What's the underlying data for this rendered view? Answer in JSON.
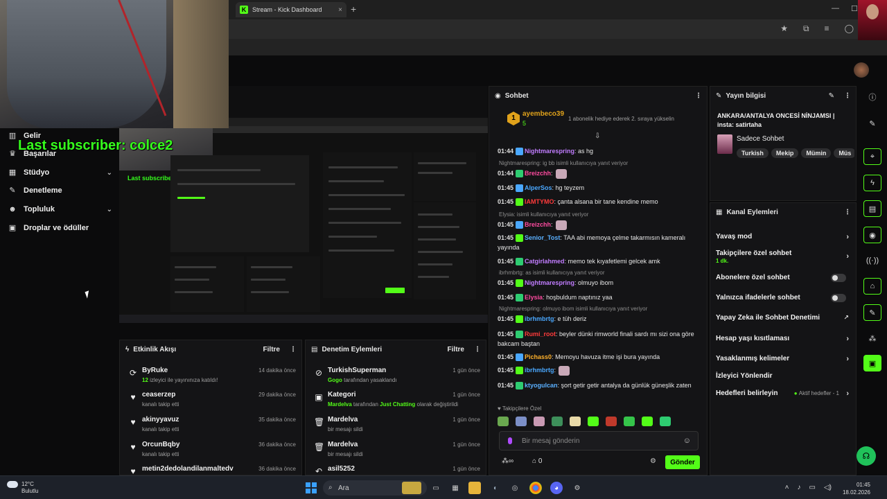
{
  "browser": {
    "tab_title": "Stream - Kick Dashboard",
    "tab_favicon": "K",
    "new_tab": "+",
    "close_tab": "×"
  },
  "overlay": {
    "last_subscriber": "Last subscriber: colce2",
    "preview_last_subscriber": "Last subscriber: colce2"
  },
  "nav": {
    "items": [
      {
        "label": "Gelir",
        "icon": "chart-icon"
      },
      {
        "label": "Başarılar",
        "icon": "trophy-icon"
      },
      {
        "label": "Stüdyo",
        "icon": "studio-icon",
        "expand": true
      },
      {
        "label": "Denetleme",
        "icon": "wrench-icon"
      },
      {
        "label": "Topluluk",
        "icon": "people-icon",
        "expand": true
      },
      {
        "label": "Droplar ve ödüller",
        "icon": "gift-icon"
      }
    ]
  },
  "activity": {
    "title": "Etkinlik Akışı",
    "filter": "Filtre",
    "rows": [
      {
        "title": "ByRuke",
        "sub_count": "12",
        "sub_text": " izleyici ile yayınınıza katıldı!",
        "time": "14 dakika önce",
        "icon": "raid-icon"
      },
      {
        "title": "ceaserzep",
        "sub_text": "kanalı takip etti",
        "time": "29 dakika önce",
        "icon": "heart-icon"
      },
      {
        "title": "akinyyavuz",
        "sub_text": "kanalı takip etti",
        "time": "35 dakika önce",
        "icon": "heart-icon"
      },
      {
        "title": "OrcunBqby",
        "sub_text": "kanalı takip etti",
        "time": "36 dakika önce",
        "icon": "heart-icon"
      },
      {
        "title": "metin2dedolandilanmaltedv",
        "sub_text": "",
        "time": "36 dakika önce",
        "icon": "heart-icon"
      }
    ]
  },
  "moderation": {
    "title": "Denetim Eylemleri",
    "filter": "Filtre",
    "rows": [
      {
        "title": "TurkishSuperman",
        "actor": "Gogo",
        "sub_text": " tarafından yasaklandı",
        "time": "1 gün önce",
        "icon": "ban-icon"
      },
      {
        "title": "Kategori",
        "actor": "Mardelva",
        "sub_text": " tarafından ",
        "target": "Just Chatting",
        "sub_text2": " olarak değiştirildi",
        "time": "1 gün önce",
        "icon": "category-icon"
      },
      {
        "title": "Mardelva",
        "sub_text": "bir mesajı sildi",
        "time": "1 gün önce",
        "icon": "trash-icon"
      },
      {
        "title": "Mardelva",
        "sub_text": "bir mesajı sildi",
        "time": "1 gün önce",
        "icon": "trash-icon"
      },
      {
        "title": "asil5252",
        "sub_text": "",
        "time": "1 gün önce",
        "icon": "undo-icon"
      }
    ]
  },
  "chat": {
    "title": "Sohbet",
    "pinned_user": "ayembeco39",
    "pinned_count": "5",
    "pinned_level": "1",
    "pinned_text": "1 abonelik hediye ederek 2. sıraya yükselin",
    "messages": [
      {
        "time": "01:44",
        "user": "Nightmarespring",
        "color": "#c17dff",
        "text": ": as hg"
      },
      {
        "reply": "Nightmarespring: ig bb isimli kullanıcıya yanıt veriyor"
      },
      {
        "time": "01:44",
        "user": "Breizchh",
        "color": "#ff4ba0",
        "text": ":",
        "emote": true
      },
      {
        "time": "01:45",
        "user": "AlperSos",
        "color": "#4aa8ff",
        "text": ": hg teyzem"
      },
      {
        "time": "01:45",
        "user": "IAMTYMO",
        "color": "#ff3b3b",
        "text": ": çanta alsana bir tane kendine memo"
      },
      {
        "reply": "Elysia: isimli kullanıcıya yanıt veriyor"
      },
      {
        "time": "01:45",
        "user": "Breizchh",
        "color": "#ff4ba0",
        "text": ":",
        "emote": true
      },
      {
        "time": "01:45",
        "user": "Senior_Tost",
        "color": "#5ab0ff",
        "text": ": TAA abi memoya çelme takarmısın kameralı yayında"
      },
      {
        "time": "01:45",
        "user": "Catgirlahmed",
        "color": "#c17dff",
        "text": ": memo tek kıyafetlemi gelcek amk"
      },
      {
        "reply": "ibrhmbrtg: as isimli kullanıcıya yanıt veriyor"
      },
      {
        "time": "01:45",
        "user": "Nightmarespring",
        "color": "#c17dff",
        "text": ": olmuyo ibom"
      },
      {
        "time": "01:45",
        "user": "Elysia",
        "color": "#ff4ba0",
        "text": ": hoşbuldum naptınız yaa"
      },
      {
        "reply": "Nightmarespring: olmuyo ibom isimli kullanıcıya yanıt veriyor"
      },
      {
        "time": "01:45",
        "user": "ibrhmbrtg",
        "color": "#4aa8ff",
        "text": ": e tüh deriz"
      },
      {
        "time": "01:45",
        "user": "Rumi_root",
        "color": "#ff3b3b",
        "text": ": beyler dünki rimworld finali sardı mı sizi ona göre bakcam baştan"
      },
      {
        "time": "01:45",
        "user": "Pichass0",
        "color": "#ffb12b",
        "text": ": Memoyu havuza itme işi bura yayında"
      },
      {
        "time": "01:45",
        "user": "ibrhmbrtg",
        "color": "#4aa8ff",
        "text": ":",
        "emote": true
      },
      {
        "time": "01:45",
        "user": "ktyogulcan",
        "color": "#5ab0ff",
        "text": ": şort getir getir antalya da günlük güneşlik zaten"
      }
    ],
    "followers_only_label": "Takipçilere Özel",
    "input_placeholder": "Bir mesaj gönderin",
    "points": "0",
    "send_label": "Gönder"
  },
  "stream_info": {
    "title": "Yayın bilgisi",
    "stream_title": "ANKARA/ANTALYA ONCESİ NİNJAMSI | insta: satirtaha",
    "category": "Sadece Sohbet",
    "tags": [
      "Turkish",
      "Mekip",
      "Mümin",
      "Müs"
    ]
  },
  "channel_actions": {
    "title": "Kanal Eylemleri",
    "slow_mode": "Yavaş mod",
    "followers_chat": "Takipçilere özel sohbet",
    "followers_chat_value": "1 dk.",
    "subscribers_chat": "Abonelere özel sohbet",
    "emotes_only": "Yalnızca ifadelerle sohbet",
    "ai_moderation": "Yapay Zeka ile Sohbet Denetimi",
    "age_restriction": "Hesap yaşı kısıtlaması",
    "banned_words": "Yasaklanmış kelimeler",
    "viewer_redirect": "İzleyici Yönlendir",
    "set_goals": "Hedefleri belirleyin",
    "goals_status": "Aktif hedefler - 1"
  },
  "taskbar": {
    "temp": "12°C",
    "weather": "Bulutlu",
    "search": "Ara",
    "time": "01:45",
    "date": "18.02.2026"
  }
}
